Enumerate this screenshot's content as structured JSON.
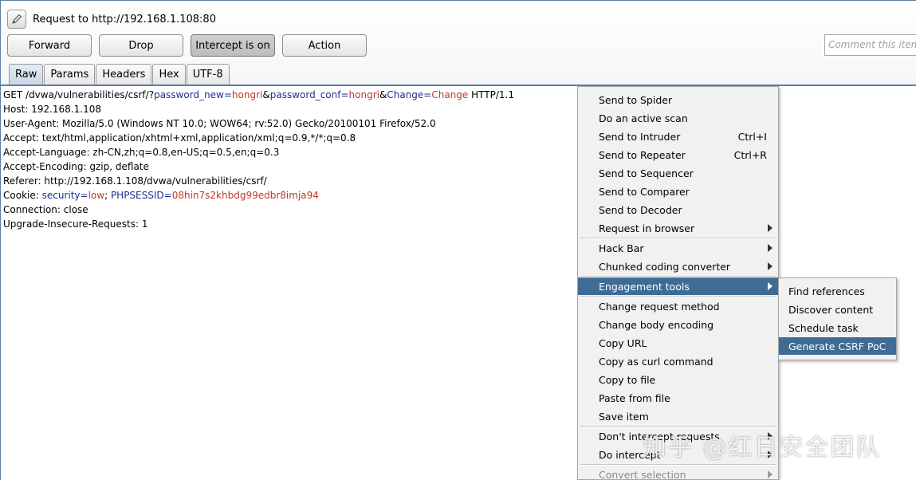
{
  "header": {
    "title": "Request to http://192.168.1.108:80",
    "icon": "pencil-icon"
  },
  "toolbar": {
    "forward_label": "Forward",
    "drop_label": "Drop",
    "intercept_label": "Intercept is on",
    "action_label": "Action",
    "comment_placeholder": "Comment this item"
  },
  "tabs": [
    "Raw",
    "Params",
    "Headers",
    "Hex",
    "UTF-8"
  ],
  "request": {
    "line1": {
      "prefix": "GET /dvwa/vulnerabilities/csrf/?",
      "p1_name": "password_new",
      "p1_value": "hongri",
      "amp1": "&",
      "p2_name": "password_conf",
      "p2_value": "hongri",
      "amp2": "&",
      "p3_name": "Change",
      "p3_value": "Change",
      "suffix": " HTTP/1.1",
      "eq": "="
    },
    "host": "Host: 192.168.1.108",
    "user_agent": "User-Agent: Mozilla/5.0 (Windows NT 10.0; WOW64; rv:52.0) Gecko/20100101 Firefox/52.0",
    "accept": "Accept: text/html,application/xhtml+xml,application/xml;q=0.9,*/*;q=0.8",
    "accept_language": "Accept-Language: zh-CN,zh;q=0.8,en-US;q=0.5,en;q=0.3",
    "accept_encoding": "Accept-Encoding: gzip, deflate",
    "referer": "Referer: http://192.168.1.108/dvwa/vulnerabilities/csrf/",
    "cookie": {
      "prefix": "Cookie: ",
      "c1_name": "security",
      "c1_value": "low",
      "sep": "; ",
      "c2_name": "PHPSESSID",
      "c2_value": "08hin7s2khbdg99edbr8imja94",
      "eq": "="
    },
    "connection": "Connection: close",
    "upgrade": "Upgrade-Insecure-Requests: 1"
  },
  "context_menu": {
    "items": [
      {
        "label": "Send to Spider"
      },
      {
        "label": "Do an active scan"
      },
      {
        "label": "Send to Intruder",
        "shortcut": "Ctrl+I"
      },
      {
        "label": "Send to Repeater",
        "shortcut": "Ctrl+R"
      },
      {
        "label": "Send to Sequencer"
      },
      {
        "label": "Send to Comparer"
      },
      {
        "label": "Send to Decoder"
      },
      {
        "label": "Request in browser"
      },
      {
        "label": "Hack Bar"
      },
      {
        "label": "Chunked coding converter"
      },
      {
        "label": "Engagement tools"
      },
      {
        "label": "Change request method"
      },
      {
        "label": "Change body encoding"
      },
      {
        "label": "Copy URL"
      },
      {
        "label": "Copy as curl command"
      },
      {
        "label": "Copy to file"
      },
      {
        "label": "Paste from file"
      },
      {
        "label": "Save item"
      },
      {
        "label": "Don't intercept requests"
      },
      {
        "label": "Do intercept"
      },
      {
        "label": "Convert selection"
      }
    ]
  },
  "submenu": {
    "items": [
      "Find references",
      "Discover content",
      "Schedule task",
      "Generate CSRF PoC"
    ]
  },
  "watermark": "知乎 @红日安全团队",
  "colors": {
    "highlight": "#3e6c94",
    "param_name": "#1c2f8e",
    "param_value": "#c0392b"
  }
}
